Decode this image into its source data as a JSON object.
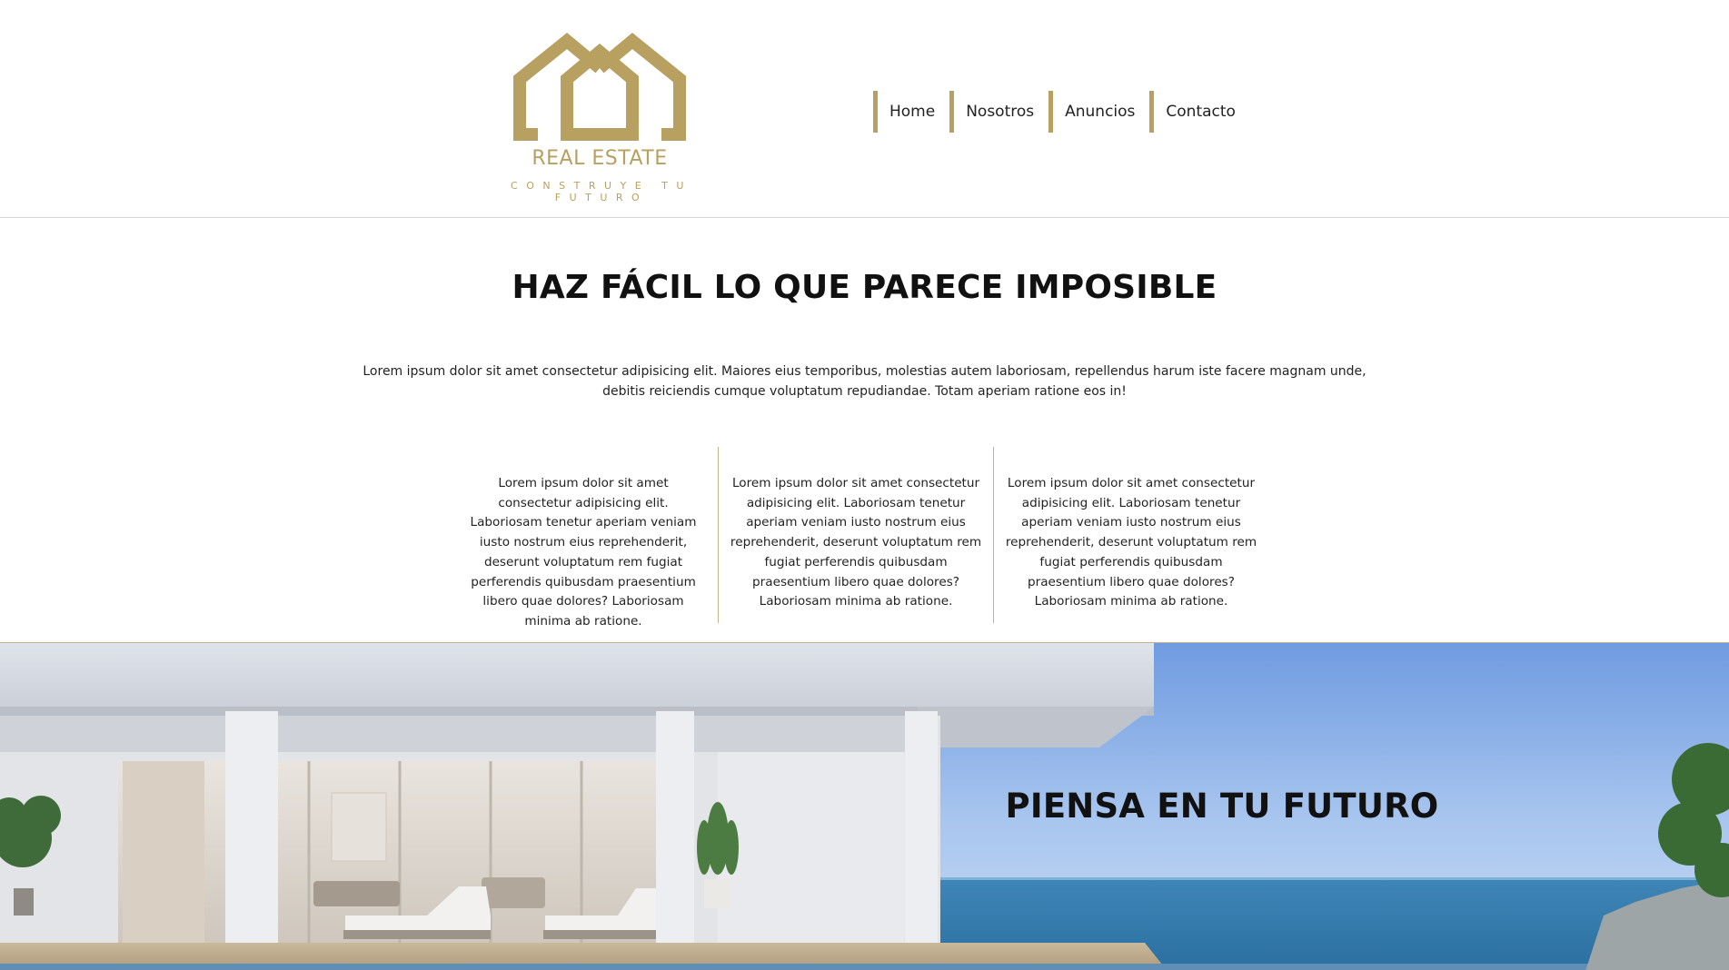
{
  "header": {
    "logo": {
      "brand": "REAL ESTATE",
      "tagline": "CONSTRUYE TU FUTURO",
      "icon": "house-pair-icon"
    },
    "nav": [
      {
        "label": "Home"
      },
      {
        "label": "Nosotros"
      },
      {
        "label": "Anuncios"
      },
      {
        "label": "Contacto"
      }
    ]
  },
  "main": {
    "headline": "HAZ FÁCIL LO QUE PARECE IMPOSIBLE",
    "intro": "Lorem ipsum dolor sit amet consectetur adipisicing elit. Maiores eius temporibus, molestias autem laboriosam, repellendus harum iste facere magnam unde, debitis reiciendis cumque voluptatum repudiandae. Totam aperiam ratione eos in!",
    "columns": [
      {
        "text": "Lorem ipsum dolor sit amet consectetur adipisicing elit. Laboriosam tenetur aperiam veniam iusto nostrum eius reprehenderit, deserunt voluptatum rem fugiat perferendis quibusdam praesentium libero quae dolores? Laboriosam minima ab ratione."
      },
      {
        "text": "Lorem ipsum dolor sit amet consectetur adipisicing elit. Laboriosam tenetur aperiam veniam iusto nostrum eius reprehenderit, deserunt voluptatum rem fugiat perferendis quibusdam praesentium libero quae dolores? Laboriosam minima ab ratione."
      },
      {
        "text": "Lorem ipsum dolor sit amet consectetur adipisicing elit. Laboriosam tenetur aperiam veniam iusto nostrum eius reprehenderit, deserunt voluptatum rem fugiat perferendis quibusdam praesentium libero quae dolores? Laboriosam minima ab ratione."
      }
    ]
  },
  "hero": {
    "title": "PIENSA EN TU FUTURO"
  },
  "colors": {
    "accent": "#b8a061",
    "text": "#111111",
    "divider": "#c5b48a"
  }
}
